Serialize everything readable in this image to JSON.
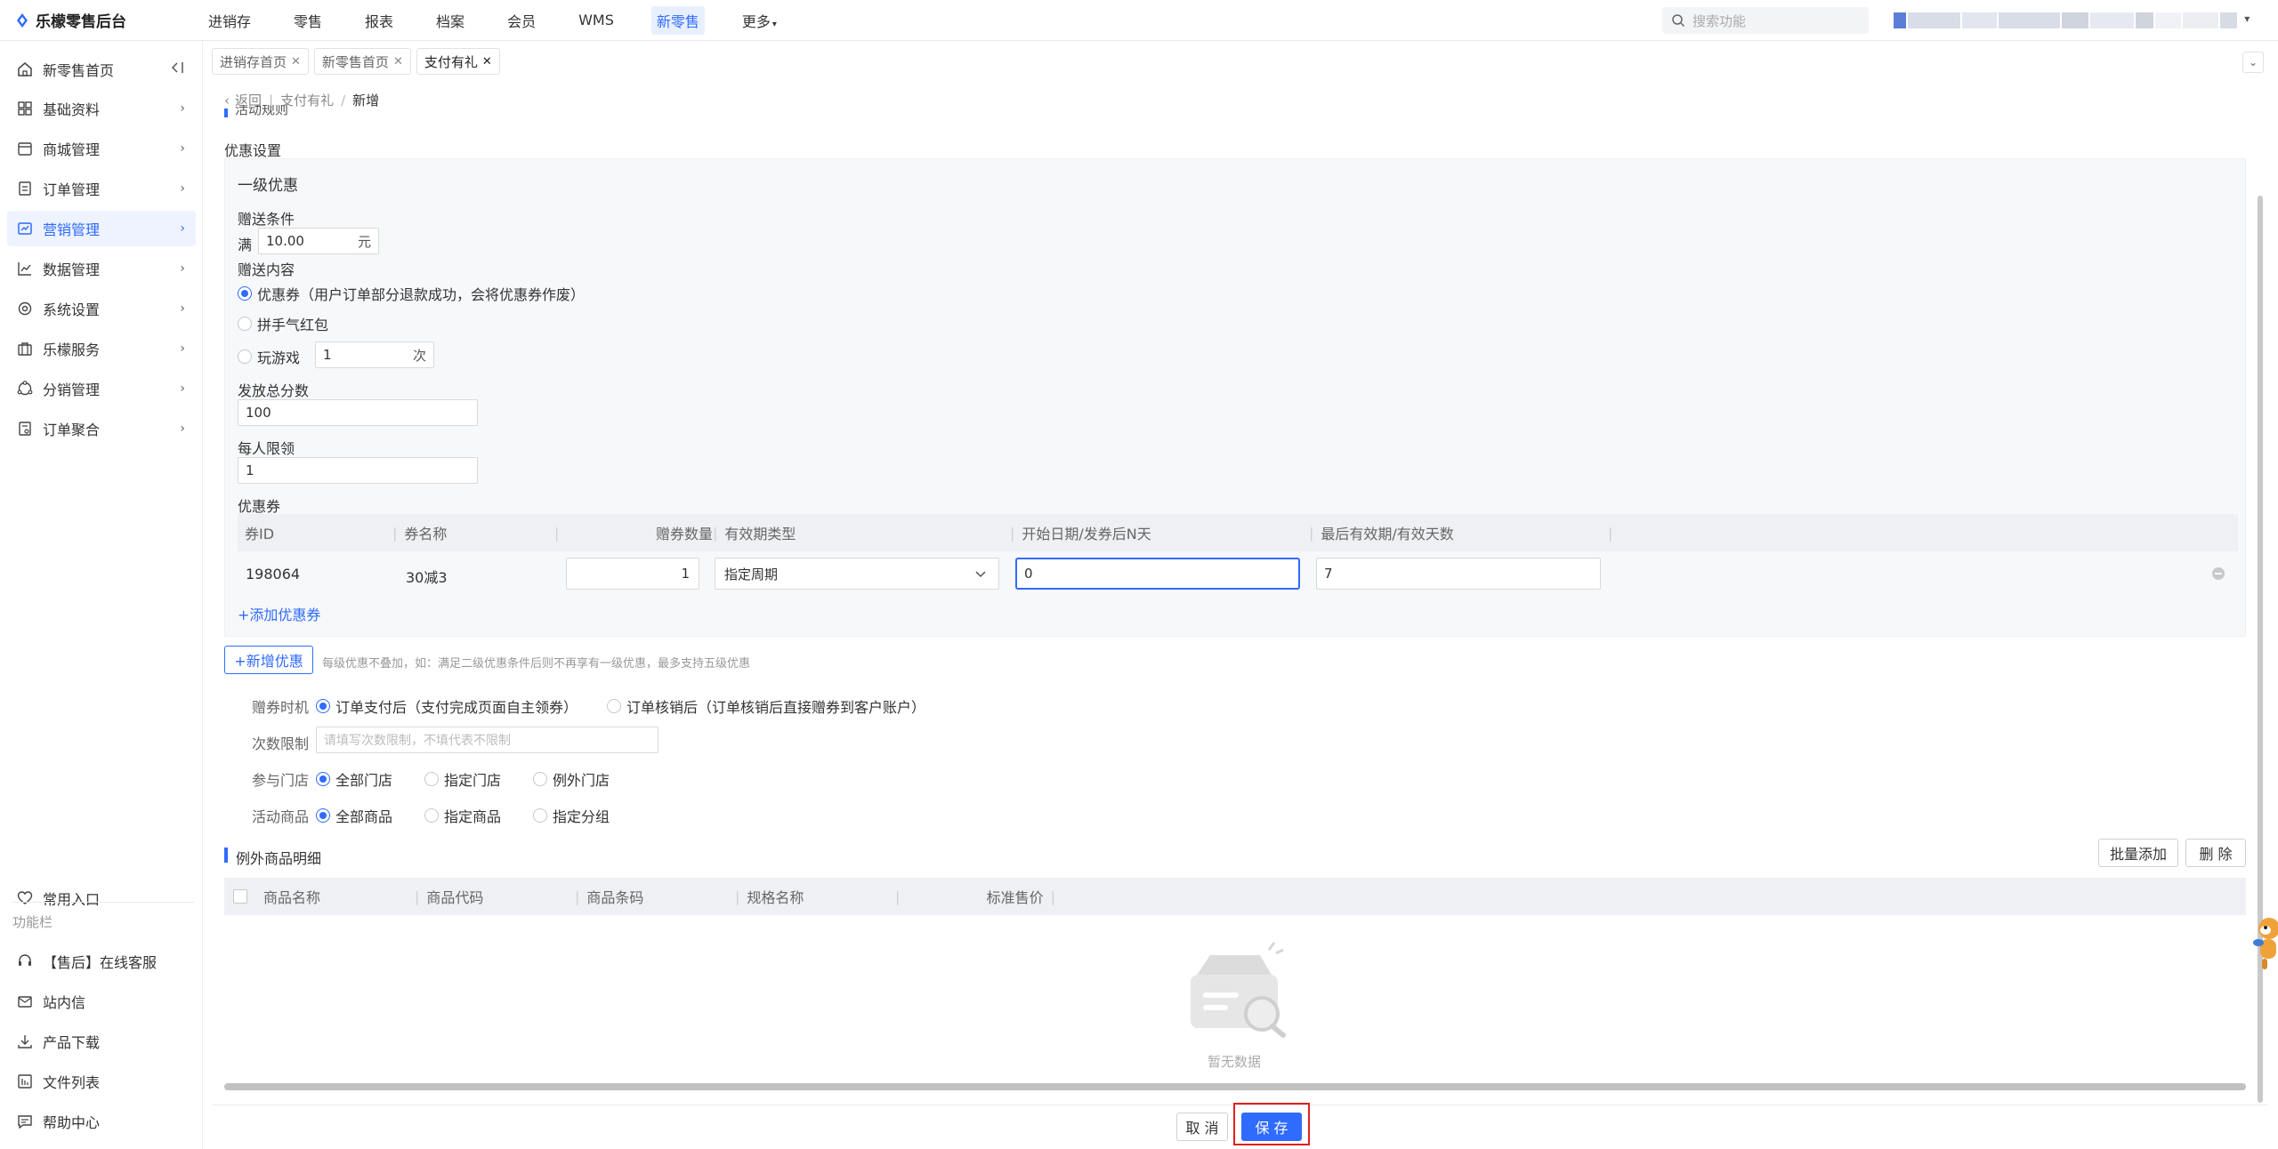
{
  "app": {
    "title": "乐檬零售后台"
  },
  "topnav": {
    "items": [
      "进销存",
      "零售",
      "报表",
      "档案",
      "会员",
      "WMS",
      "新零售",
      "更多"
    ],
    "search_placeholder": "搜索功能"
  },
  "sidebar": {
    "items": [
      {
        "label": "新零售首页"
      },
      {
        "label": "基础资料"
      },
      {
        "label": "商城管理"
      },
      {
        "label": "订单管理"
      },
      {
        "label": "营销管理"
      },
      {
        "label": "数据管理"
      },
      {
        "label": "系统设置"
      },
      {
        "label": "乐檬服务"
      },
      {
        "label": "分销管理"
      },
      {
        "label": "订单聚合"
      }
    ],
    "common_entry": "常用入口",
    "function_bar_title": "功能栏",
    "function_items": [
      "【售后】在线客服",
      "站内信",
      "产品下载",
      "文件列表",
      "帮助中心"
    ]
  },
  "tabs": [
    {
      "label": "进销存首页"
    },
    {
      "label": "新零售首页"
    },
    {
      "label": "支付有礼"
    }
  ],
  "breadcrumb": {
    "back": "返回",
    "parent": "支付有礼",
    "current": "新增"
  },
  "form": {
    "section_rule_title": "活动规则",
    "discount_settings_label": "优惠设置",
    "level1_title": "一级优惠",
    "gift_condition_label": "赠送条件",
    "full_prefix": "满",
    "full_amount": "10.00",
    "full_unit": "元",
    "gift_content_label": "赠送内容",
    "content_options": [
      "优惠券（用户订单部分退款成功，会将优惠券作废）",
      "拼手气红包",
      "玩游戏"
    ],
    "game_times": "1",
    "game_times_unit": "次",
    "total_portions_label": "发放总分数",
    "total_portions": "100",
    "per_person_label": "每人限领",
    "per_person": "1",
    "coupon_label": "优惠券",
    "coupon_table": {
      "headers": [
        "券ID",
        "券名称",
        "赠券数量",
        "有效期类型",
        "开始日期/发券后N天",
        "最后有效期/有效天数"
      ],
      "rows": [
        {
          "id": "198064",
          "name": "30减3",
          "qty": "1",
          "validity_type": "指定周期",
          "start": "0",
          "end": "7"
        }
      ]
    },
    "add_coupon_link": "+添加优惠券",
    "add_discount_button": "+新增优惠",
    "add_discount_hint": "每级优惠不叠加，如：满足二级优惠条件后则不再享有一级优惠，最多支持五级优惠",
    "gift_timing_label": "赠券时机",
    "gift_timing_options": [
      "订单支付后（支付完成页面自主领券）",
      "订单核销后（订单核销后直接赠券到客户账户）"
    ],
    "times_limit_label": "次数限制",
    "times_limit_placeholder": "请填写次数限制，不填代表不限制",
    "store_label": "参与门店",
    "store_options": [
      "全部门店",
      "指定门店",
      "例外门店"
    ],
    "goods_label": "活动商品",
    "goods_options": [
      "全部商品",
      "指定商品",
      "指定分组"
    ]
  },
  "exception_goods": {
    "title": "例外商品明细",
    "batch_add_button": "批量添加",
    "delete_button": "删 除",
    "headers": [
      "商品名称",
      "商品代码",
      "商品条码",
      "规格名称",
      "标准售价"
    ],
    "empty_text": "暂无数据"
  },
  "footer": {
    "cancel_button": "取 消",
    "save_button": "保 存"
  },
  "colors": {
    "accent": "#2f6bff",
    "highlight": "#e02020"
  }
}
